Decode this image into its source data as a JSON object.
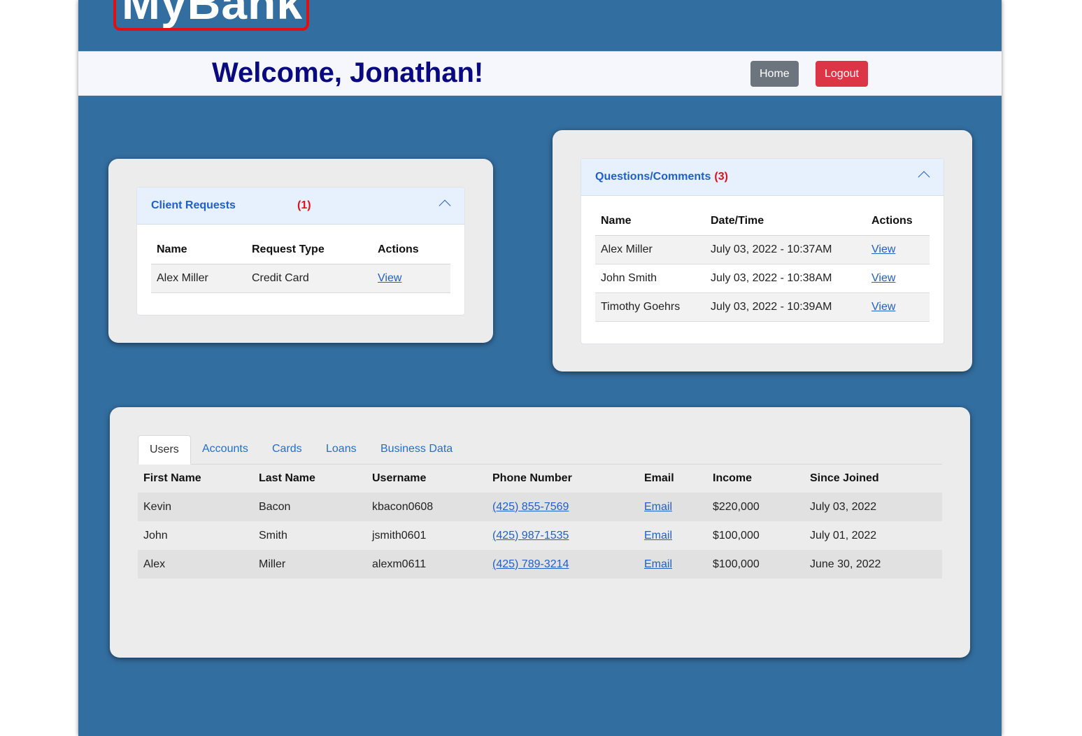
{
  "brand": {
    "logo_text": "MyBank"
  },
  "header": {
    "welcome": "Welcome, Jonathan!",
    "home_label": "Home",
    "logout_label": "Logout"
  },
  "client_requests": {
    "title": "Client Requests",
    "count": "(1)",
    "columns": [
      "Name",
      "Request Type",
      "Actions"
    ],
    "rows": [
      {
        "name": "Alex Miller",
        "type": "Credit Card",
        "action": "View"
      }
    ]
  },
  "questions": {
    "title": "Questions/Comments",
    "count": "(3)",
    "columns": [
      "Name",
      "Date/Time",
      "Actions"
    ],
    "rows": [
      {
        "name": "Alex Miller",
        "datetime": "July 03, 2022 - 10:37AM",
        "action": "View"
      },
      {
        "name": "John Smith",
        "datetime": "July 03, 2022 - 10:38AM",
        "action": "View"
      },
      {
        "name": "Timothy Goehrs",
        "datetime": "July 03, 2022 - 10:39AM",
        "action": "View"
      }
    ]
  },
  "data_panel": {
    "tabs": [
      "Users",
      "Accounts",
      "Cards",
      "Loans",
      "Business Data"
    ],
    "active_tab": "Users",
    "columns": [
      "First Name",
      "Last Name",
      "Username",
      "Phone Number",
      "Email",
      "Income",
      "Since Joined"
    ],
    "rows": [
      {
        "first": "Kevin",
        "last": "Bacon",
        "username": "kbacon0608",
        "phone": "(425) 855-7569",
        "email": "Email",
        "income": "$220,000",
        "joined": "July 03, 2022"
      },
      {
        "first": "John",
        "last": "Smith",
        "username": "jsmith0601",
        "phone": "(425) 987-1535",
        "email": "Email",
        "income": "$100,000",
        "joined": "July 01, 2022"
      },
      {
        "first": "Alex",
        "last": "Miller",
        "username": "alexm0611",
        "phone": "(425) 789-3214",
        "email": "Email",
        "income": "$100,000",
        "joined": "June 30, 2022"
      }
    ]
  },
  "colors": {
    "page_bg": "#336ea0",
    "welcome_text": "#0a0a80",
    "link": "#1f5fc8",
    "count_badge": "#e0101a",
    "logout_button": "#dc3545",
    "home_button": "#6c757d",
    "logo_border": "#e01010"
  },
  "icons": {
    "accordion_toggle": "chevron-up-icon"
  }
}
